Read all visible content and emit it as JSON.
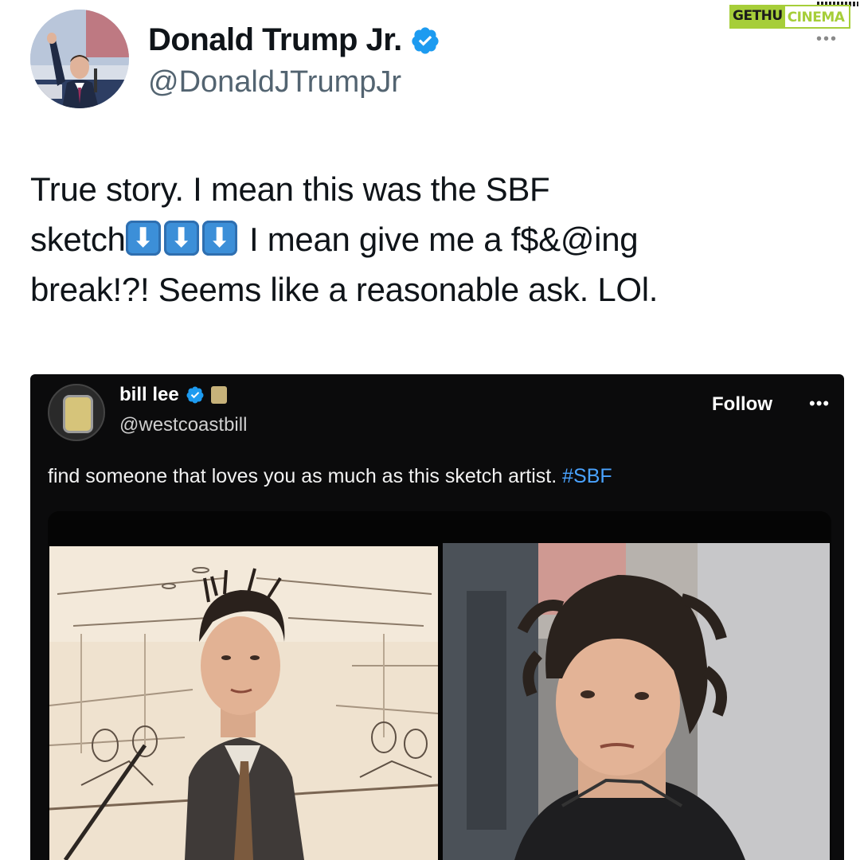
{
  "watermark": {
    "part1": "GETHU",
    "part2": "CINEMA",
    "more": "•••"
  },
  "author": {
    "name": "Donald Trump Jr.",
    "handle": "@DonaldJTrumpJr",
    "verified": true,
    "avatar_icon": "profile-photo"
  },
  "tweet": {
    "line1": "True story. I mean this was the SBF",
    "line2_before": "sketch",
    "arrow_icon": "down-arrow-emoji",
    "arrow_count": 3,
    "line2_after": " I mean give me a f$&@ing",
    "line3": "break!?!  Seems like a reasonable ask. LOl."
  },
  "embedded_post": {
    "name": "bill lee",
    "handle": "@westcoastbill",
    "follow_label": "Follow",
    "more_label": "•••",
    "text": "find someone that loves you as much as this sketch artist. ",
    "hashtag": "#SBF",
    "media": [
      "courtroom-sketch-image",
      "photo-image"
    ]
  },
  "colors": {
    "verified_blue": "#1d9bf0",
    "handle_gray": "#536471",
    "embed_bg": "#0b0b0c",
    "hashtag_blue": "#4aa3ff",
    "watermark_green": "#a6ce39"
  }
}
